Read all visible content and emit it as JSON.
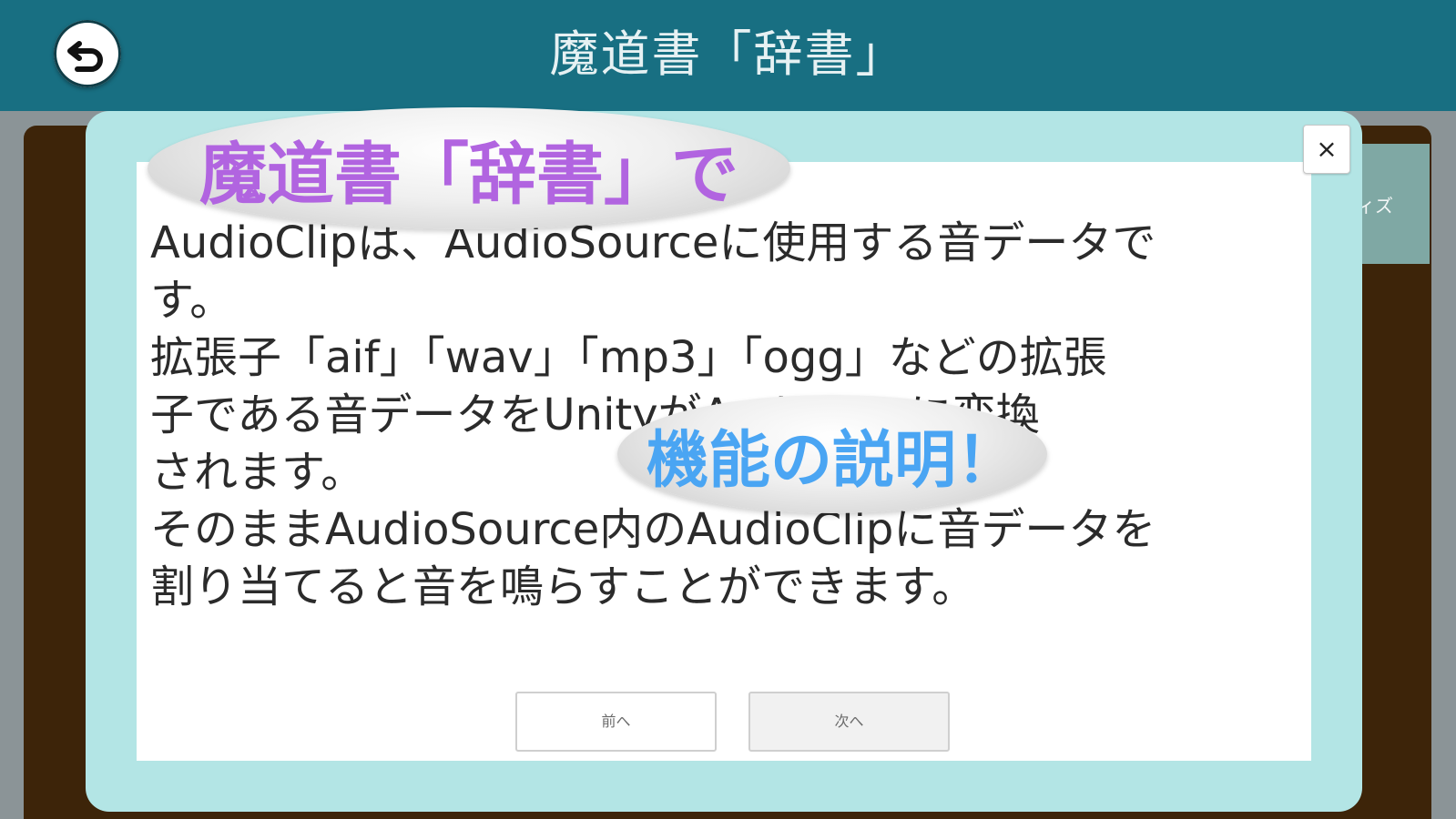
{
  "header": {
    "title": "魔道書「辞書」"
  },
  "side_tab": {
    "label": "ィズ"
  },
  "modal": {
    "close_label": "×",
    "body_lines": [
      "AudioClipは、AudioSourceに使用する音データで",
      "す。",
      "拡張子「aif」「wav」「mp3」「ogg」などの拡張",
      "子である音データをUnityがAudioClipに変換",
      "されます。",
      "そのままAudioSource内のAudioClipに音データを",
      "割り当てると音を鳴らすことができます。"
    ],
    "prev_label": "前へ",
    "next_label": "次へ"
  },
  "overlays": {
    "bubble_1": "魔道書「辞書」で",
    "bubble_2": "機能の説明！"
  },
  "colors": {
    "header": "#186f82",
    "modal_frame": "#b3e5e5",
    "book_frame": "#3d2409",
    "bubble_1_text": "#b164e0",
    "bubble_2_text": "#4aa5f3"
  },
  "icons": {
    "back": "undo-arrow-icon",
    "close": "close-icon"
  }
}
